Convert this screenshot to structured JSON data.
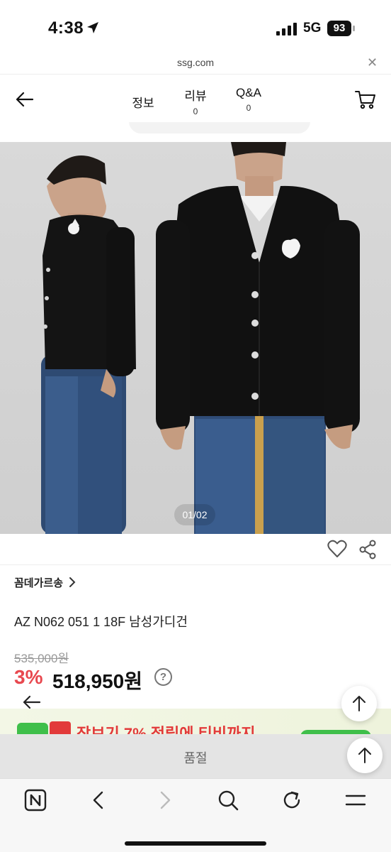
{
  "status_bar": {
    "time": "4:38",
    "network": "5G",
    "battery": "93"
  },
  "url_bar": {
    "domain": "ssg.com"
  },
  "header": {
    "tabs": [
      {
        "label": "정보"
      },
      {
        "label": "리뷰",
        "count": "0"
      },
      {
        "label": "Q&A",
        "count": "0"
      }
    ]
  },
  "product": {
    "image_counter": "01/02",
    "brand": "꼼데가르송",
    "title": "AZ N062 051 1 18F 남성가디건",
    "original_price": "535,000원",
    "discount": "3%",
    "sale_price": "518,950원",
    "help_symbol": "?"
  },
  "promo": {
    "text": "장보기 7% 적립에 티비까지"
  },
  "quality_bar": {
    "label": "품절"
  },
  "icons": {
    "back": "arrow-left-icon",
    "cart": "cart-icon",
    "heart": "heart-icon",
    "share": "share-icon",
    "scroll_top": "arrow-up-icon",
    "browser_n": "n-logo-icon",
    "browser_back": "chevron-left-icon",
    "browser_forward": "chevron-right-icon",
    "search": "search-icon",
    "refresh": "refresh-icon",
    "menu": "menu-icon"
  },
  "colors": {
    "discount": "#e8484f",
    "promo_red": "#e23a3a",
    "promo_green": "#3fbf4a",
    "sold_out_bar": "#e4e4e4"
  }
}
